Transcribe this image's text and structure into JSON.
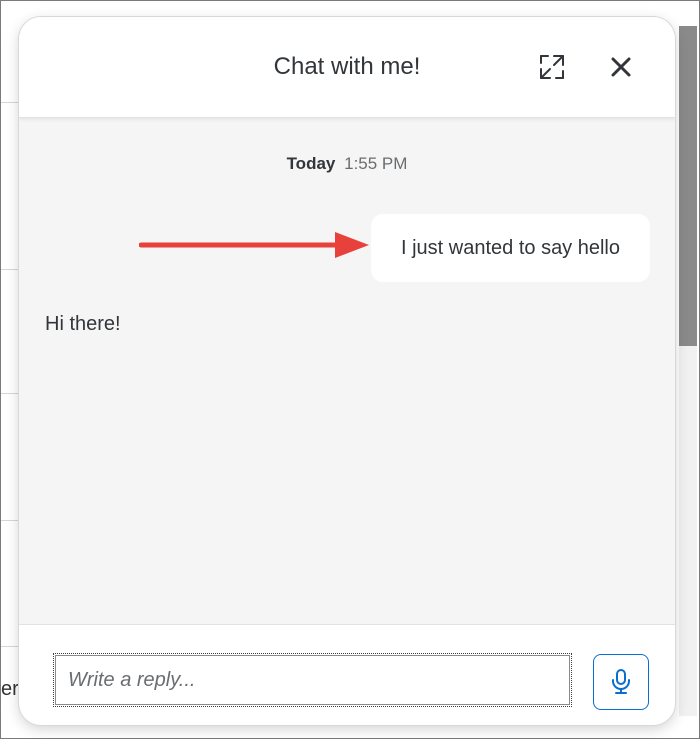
{
  "chat": {
    "title": "Chat with me!",
    "timestamp": {
      "day": "Today",
      "time": "1:55 PM"
    },
    "messages": [
      {
        "direction": "outgoing",
        "text": "I just wanted to say hello"
      },
      {
        "direction": "incoming",
        "text": "Hi there!"
      }
    ],
    "reply": {
      "placeholder": "Write a reply...",
      "value": ""
    }
  },
  "background": {
    "edge_text": "er)"
  },
  "icons": {
    "expand": "expand-icon",
    "close": "close-icon",
    "microphone": "microphone-icon",
    "annotation": "red-arrow-annotation"
  },
  "colors": {
    "accent": "#0a6ed1",
    "arrow": "#e8413b",
    "text": "#32363a",
    "chat_background": "#f5f5f5"
  }
}
